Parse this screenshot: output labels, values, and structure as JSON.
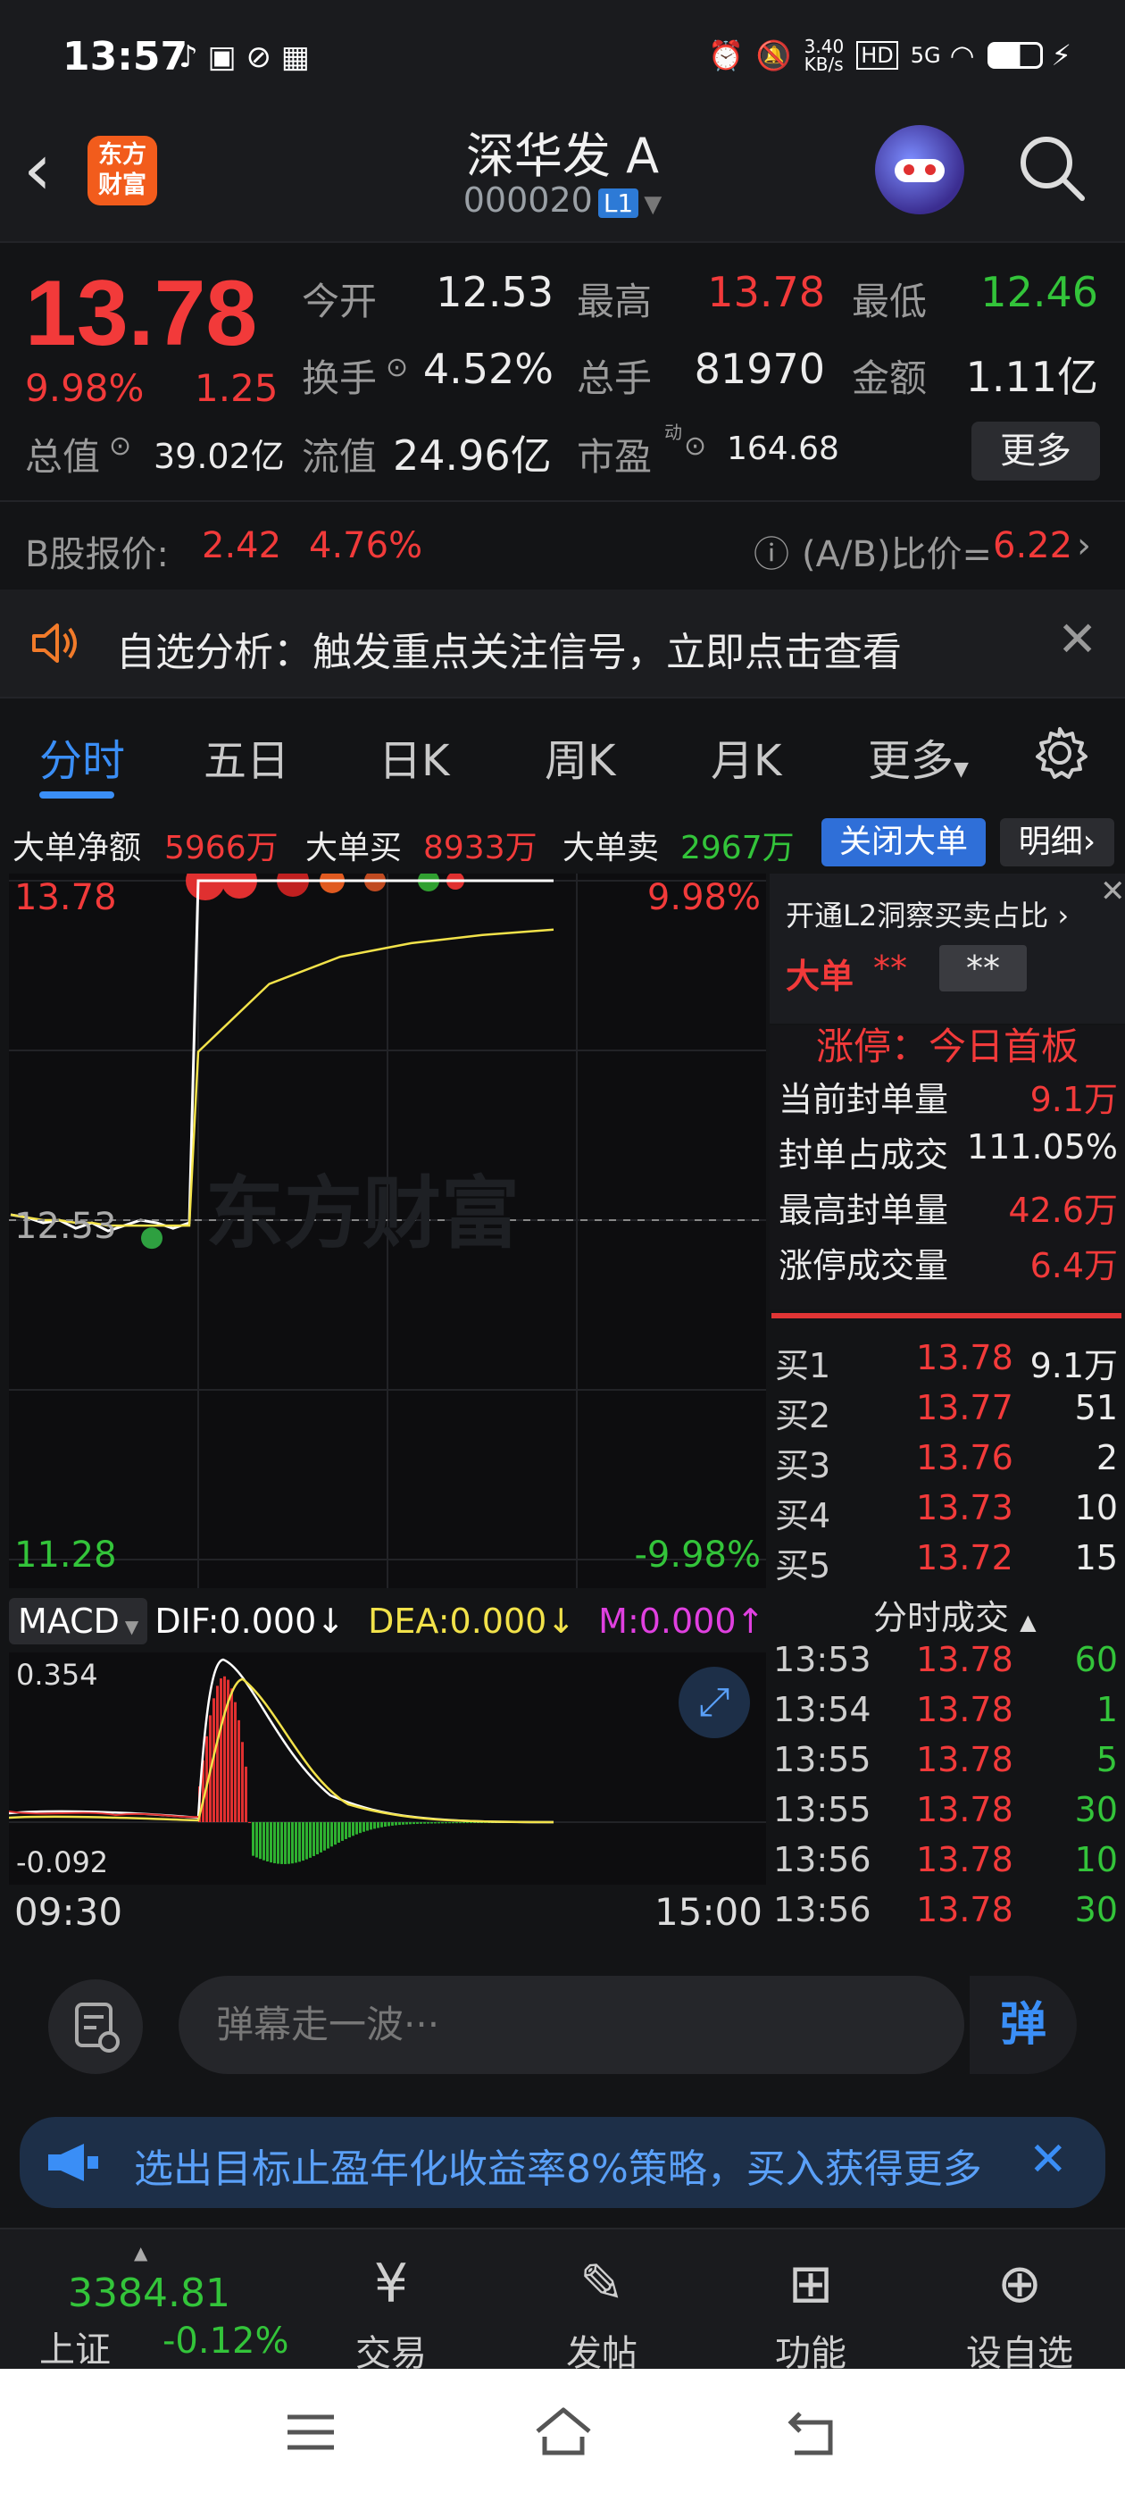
{
  "status_bar": {
    "time": "13:57",
    "net_speed": "3.40\nKB/s",
    "signal": "5G"
  },
  "header": {
    "logo_text": "东方\n财富",
    "stock_name": "深华发 A",
    "stock_code": "000020",
    "level_badge": "L1"
  },
  "quote": {
    "price": "13.78",
    "change_pct": "9.98%",
    "change_amt": "1.25",
    "fields": [
      {
        "label": "今开",
        "value": "12.53",
        "color": "white"
      },
      {
        "label": "最高",
        "value": "13.78",
        "color": "red"
      },
      {
        "label": "最低",
        "value": "12.46",
        "color": "green"
      },
      {
        "label": "换手",
        "value": "4.52%",
        "color": "white"
      },
      {
        "label": "总手",
        "value": "81970",
        "color": "white"
      },
      {
        "label": "金额",
        "value": "1.11亿",
        "color": "white"
      },
      {
        "label": "总值",
        "value": "39.02亿",
        "color": "white"
      },
      {
        "label": "流值",
        "value": "24.96亿",
        "color": "white"
      },
      {
        "label": "市盈",
        "value": "164.68",
        "color": "white"
      }
    ],
    "pe_superscript": "动",
    "more_label": "更多"
  },
  "bshare": {
    "label": "B股报价:",
    "price": "2.42",
    "pct": "4.76%",
    "ratio_label": "(A/B)比价=",
    "ratio_value": "6.22"
  },
  "notify": {
    "text": "自选分析：触发重点关注信号，立即点击查看"
  },
  "tabs": [
    {
      "label": "分时",
      "active": true
    },
    {
      "label": "五日"
    },
    {
      "label": "日K"
    },
    {
      "label": "周K"
    },
    {
      "label": "月K"
    },
    {
      "label": "更多"
    }
  ],
  "big_order": {
    "net_label": "大单净额",
    "net_value": "5966万",
    "buy_label": "大单买",
    "buy_value": "8933万",
    "sell_label": "大单卖",
    "sell_value": "2967万",
    "close_label": "关闭大单",
    "detail_label": "明细"
  },
  "chart_data": {
    "type": "line",
    "y_top": "13.78",
    "y_top_pct": "9.98%",
    "y_ref": "12.53",
    "y_bottom": "11.28",
    "y_bottom_pct": "-9.98%",
    "x_start": "09:30",
    "x_end": "15:00",
    "ylim": [
      11.28,
      13.78
    ],
    "ref_price": 12.53,
    "price_series": [
      12.55,
      12.54,
      12.52,
      12.53,
      12.5,
      12.52,
      12.49,
      12.51,
      12.53,
      12.52,
      12.5,
      12.52,
      13.78,
      13.78,
      13.78,
      13.78,
      13.78,
      13.78
    ],
    "avg_series": [
      12.55,
      12.54,
      12.53,
      12.53,
      12.52,
      12.52,
      12.51,
      12.51,
      12.51,
      12.51,
      12.51,
      12.51,
      13.15,
      13.4,
      13.5,
      13.55,
      13.58,
      13.6
    ],
    "watermark": "东方财富",
    "macd": {
      "label": "MACD",
      "dif": "DIF:0.000",
      "dea": "DEA:0.000",
      "m": "M:0.000",
      "top": "0.354",
      "bottom": "-0.092"
    }
  },
  "right_panel": {
    "l2_promo": "开通L2洞察买卖占比",
    "big_order_label": "大单",
    "big_order_masked": "**",
    "big_order_masked2": "**",
    "limit_title": "涨停：今日首板",
    "limit_rows": [
      {
        "label": "当前封单量",
        "value": "9.1万"
      },
      {
        "label": "封单占成交",
        "value": "111.05%"
      },
      {
        "label": "最高封单量",
        "value": "42.6万"
      },
      {
        "label": "涨停成交量",
        "value": "6.4万"
      }
    ],
    "bids": [
      {
        "label": "买1",
        "price": "13.78",
        "vol": "9.1万"
      },
      {
        "label": "买2",
        "price": "13.77",
        "vol": "51"
      },
      {
        "label": "买3",
        "price": "13.76",
        "vol": "2"
      },
      {
        "label": "买4",
        "price": "13.73",
        "vol": "10"
      },
      {
        "label": "买5",
        "price": "13.72",
        "vol": "15"
      }
    ],
    "ticks_title": "分时成交",
    "ticks": [
      {
        "time": "13:53",
        "price": "13.78",
        "vol": "60"
      },
      {
        "time": "13:54",
        "price": "13.78",
        "vol": "1"
      },
      {
        "time": "13:55",
        "price": "13.78",
        "vol": "5"
      },
      {
        "time": "13:55",
        "price": "13.78",
        "vol": "30"
      },
      {
        "time": "13:56",
        "price": "13.78",
        "vol": "10"
      },
      {
        "time": "13:56",
        "price": "13.78",
        "vol": "30"
      }
    ]
  },
  "input_bar": {
    "placeholder": "弹幕走一波···",
    "send_label": "弹"
  },
  "ad": {
    "text": "选出目标止盈年化收益率8%策略，买入获得更多"
  },
  "bottom_nav": {
    "index_value": "3384.81",
    "index_name": "上证",
    "index_change": "-0.12%",
    "items": [
      {
        "label": "交易",
        "icon": "trade-icon"
      },
      {
        "label": "发帖",
        "icon": "post-icon"
      },
      {
        "label": "功能",
        "icon": "grid-icon"
      },
      {
        "label": "设自选",
        "icon": "add-watch-icon"
      }
    ]
  }
}
